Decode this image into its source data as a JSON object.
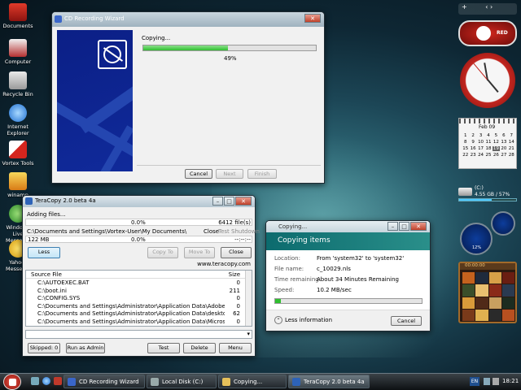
{
  "desktop_icons": [
    "Documents",
    "Computer",
    "Recycle Bin",
    "Internet Explorer",
    "Vortex Tools",
    "winamp",
    "Windows Live Messenger",
    "Yahoo! Messenger"
  ],
  "cd_wizard": {
    "title": "CD Recording Wizard",
    "status": "Copying...",
    "progress_pct": 0.49,
    "percent_label": "49%",
    "buttons": {
      "cancel": "Cancel",
      "next": "Next",
      "finish": "Finish"
    }
  },
  "teracopy": {
    "title": "TeraCopy 2.0 beta 4a",
    "adding": "Adding files...",
    "pct1": "0.0%",
    "files": "6412 file(s)",
    "path": "C:\\Documents and Settings\\Vortex-User\\My Documents\\",
    "close": "Close",
    "test": "Test",
    "shutdown": "Shutdown",
    "size": "122 MB",
    "pct2": "0.0%",
    "eta": "--:--:--",
    "btn_less": "Less",
    "btn_copy": "Copy To",
    "btn_move": "Move To",
    "btn_close": "Close",
    "website": "www.teracopy.com",
    "col_source": "Source File",
    "col_size": "Size",
    "rows": [
      {
        "file": "C:\\AUTOEXEC.BAT",
        "size": "0"
      },
      {
        "file": "C:\\boot.ini",
        "size": "211"
      },
      {
        "file": "C:\\CONFIG.SYS",
        "size": "0"
      },
      {
        "file": "C:\\Documents and Settings\\Administrator\\Application Data\\Adobe\\Flash P...",
        "size": "0"
      },
      {
        "file": "C:\\Documents and Settings\\Administrator\\Application Data\\desktop.ini",
        "size": "62"
      },
      {
        "file": "C:\\Documents and Settings\\Administrator\\Application Data\\Microsoft\\Cre...",
        "size": "0"
      }
    ],
    "skipped": "Skipped: 0",
    "run_admin": "Run as Admin",
    "btn_test": "Test",
    "btn_delete": "Delete",
    "btn_menu": "Menu"
  },
  "copying": {
    "title": "Copying...",
    "heading": "Copying items",
    "location_label": "Location:",
    "location": "From 'system32' to 'system32'",
    "file_label": "File name:",
    "file": "c_10029.nls",
    "time_label": "Time remaining:",
    "time": "About 34 Minutes Remaining",
    "speed_label": "Speed:",
    "speed": "10.2 MB/sec",
    "progress_pct": 0.04,
    "less_info": "Less information",
    "cancel": "Cancel"
  },
  "sidebar": {
    "red_logo": "RED",
    "calendar_month": "Feb 09",
    "calendar_days": [
      "1",
      "2",
      "3",
      "4",
      "5",
      "6",
      "7",
      "8",
      "9",
      "10",
      "11",
      "12",
      "13",
      "14",
      "15",
      "16",
      "17",
      "18",
      "19",
      "20",
      "21",
      "22",
      "23",
      "24",
      "25",
      "26",
      "27",
      "28"
    ],
    "calendar_today": "19",
    "drive_label": "(C:)",
    "drive_info": "4.55 GB / 57%",
    "gauge_label": "12%",
    "timer": "00:00:00"
  },
  "taskbar": {
    "items": [
      "CD Recording Wizard",
      "Local Disk (C:)",
      "Copying...",
      "TeraCopy 2.0 beta 4a"
    ],
    "lang": "EN",
    "time": "18:21"
  },
  "colors": {
    "accent_green": "#2fbf2f",
    "teracopy_blue": "#2d63b8",
    "wizard_navy": "#0b1f86"
  }
}
